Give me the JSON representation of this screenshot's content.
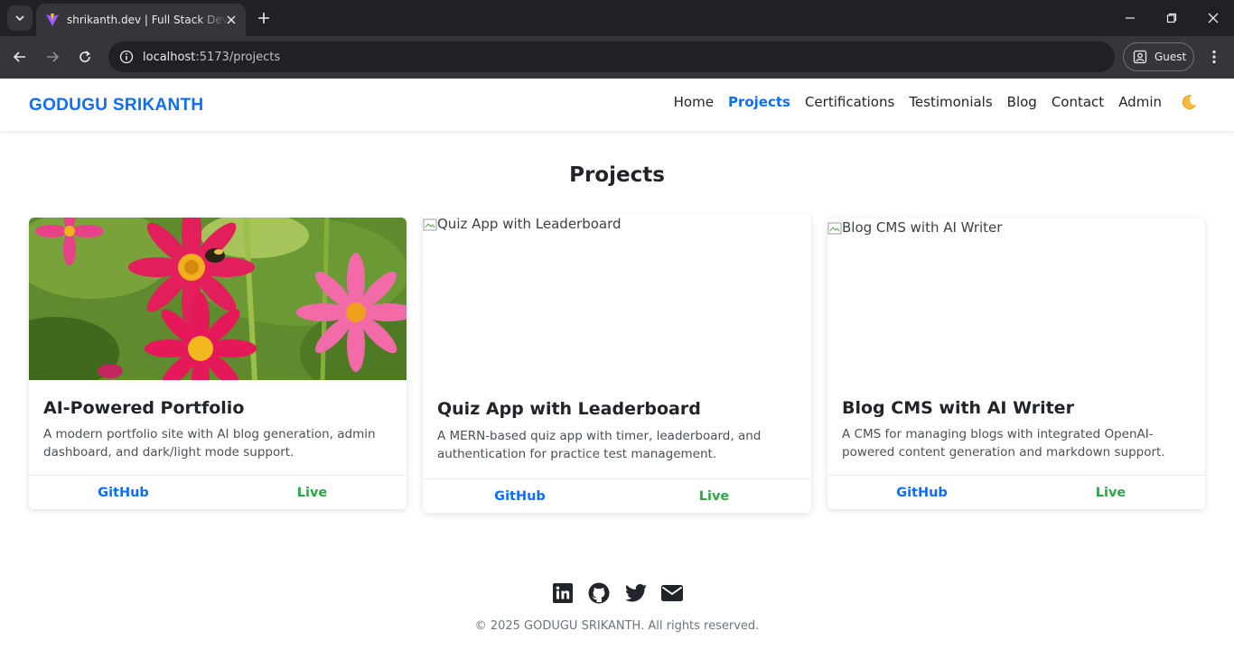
{
  "browser": {
    "tab_title": "shrikanth.dev | Full Stack Developer",
    "url_host": "localhost",
    "url_path": ":5173/projects",
    "profile_label": "Guest"
  },
  "site": {
    "brand": "GODUGU SRIKANTH",
    "nav": [
      {
        "label": "Home",
        "active": false
      },
      {
        "label": "Projects",
        "active": true
      },
      {
        "label": "Certifications",
        "active": false
      },
      {
        "label": "Testimonials",
        "active": false
      },
      {
        "label": "Blog",
        "active": false
      },
      {
        "label": "Contact",
        "active": false
      },
      {
        "label": "Admin",
        "active": false
      }
    ],
    "theme_toggle_icon": "moon-icon"
  },
  "page": {
    "title": "Projects"
  },
  "projects": [
    {
      "title": "AI-Powered Portfolio",
      "description": "A modern portfolio site with AI blog generation, admin dashboard, and dark/light mode support.",
      "image_alt": "",
      "image_loaded": true,
      "github_label": "GitHub",
      "live_label": "Live"
    },
    {
      "title": "Quiz App with Leaderboard",
      "description": "A MERN-based quiz app with timer, leaderboard, and authentication for practice test management.",
      "image_alt": "Quiz App with Leaderboard",
      "image_loaded": false,
      "github_label": "GitHub",
      "live_label": "Live"
    },
    {
      "title": "Blog CMS with AI Writer",
      "description": "A CMS for managing blogs with integrated OpenAI-powered content generation and markdown support.",
      "image_alt": "Blog CMS with AI Writer",
      "image_loaded": false,
      "github_label": "GitHub",
      "live_label": "Live"
    }
  ],
  "footer": {
    "icons": [
      "linkedin-icon",
      "github-icon",
      "twitter-icon",
      "email-icon"
    ],
    "copyright": "© 2025 GODUGU SRIKANTH. All rights reserved."
  },
  "colors": {
    "accent": "#0d6efd",
    "live": "#28a745",
    "chrome_dark": "#202124",
    "chrome_toolbar": "#35363a"
  }
}
